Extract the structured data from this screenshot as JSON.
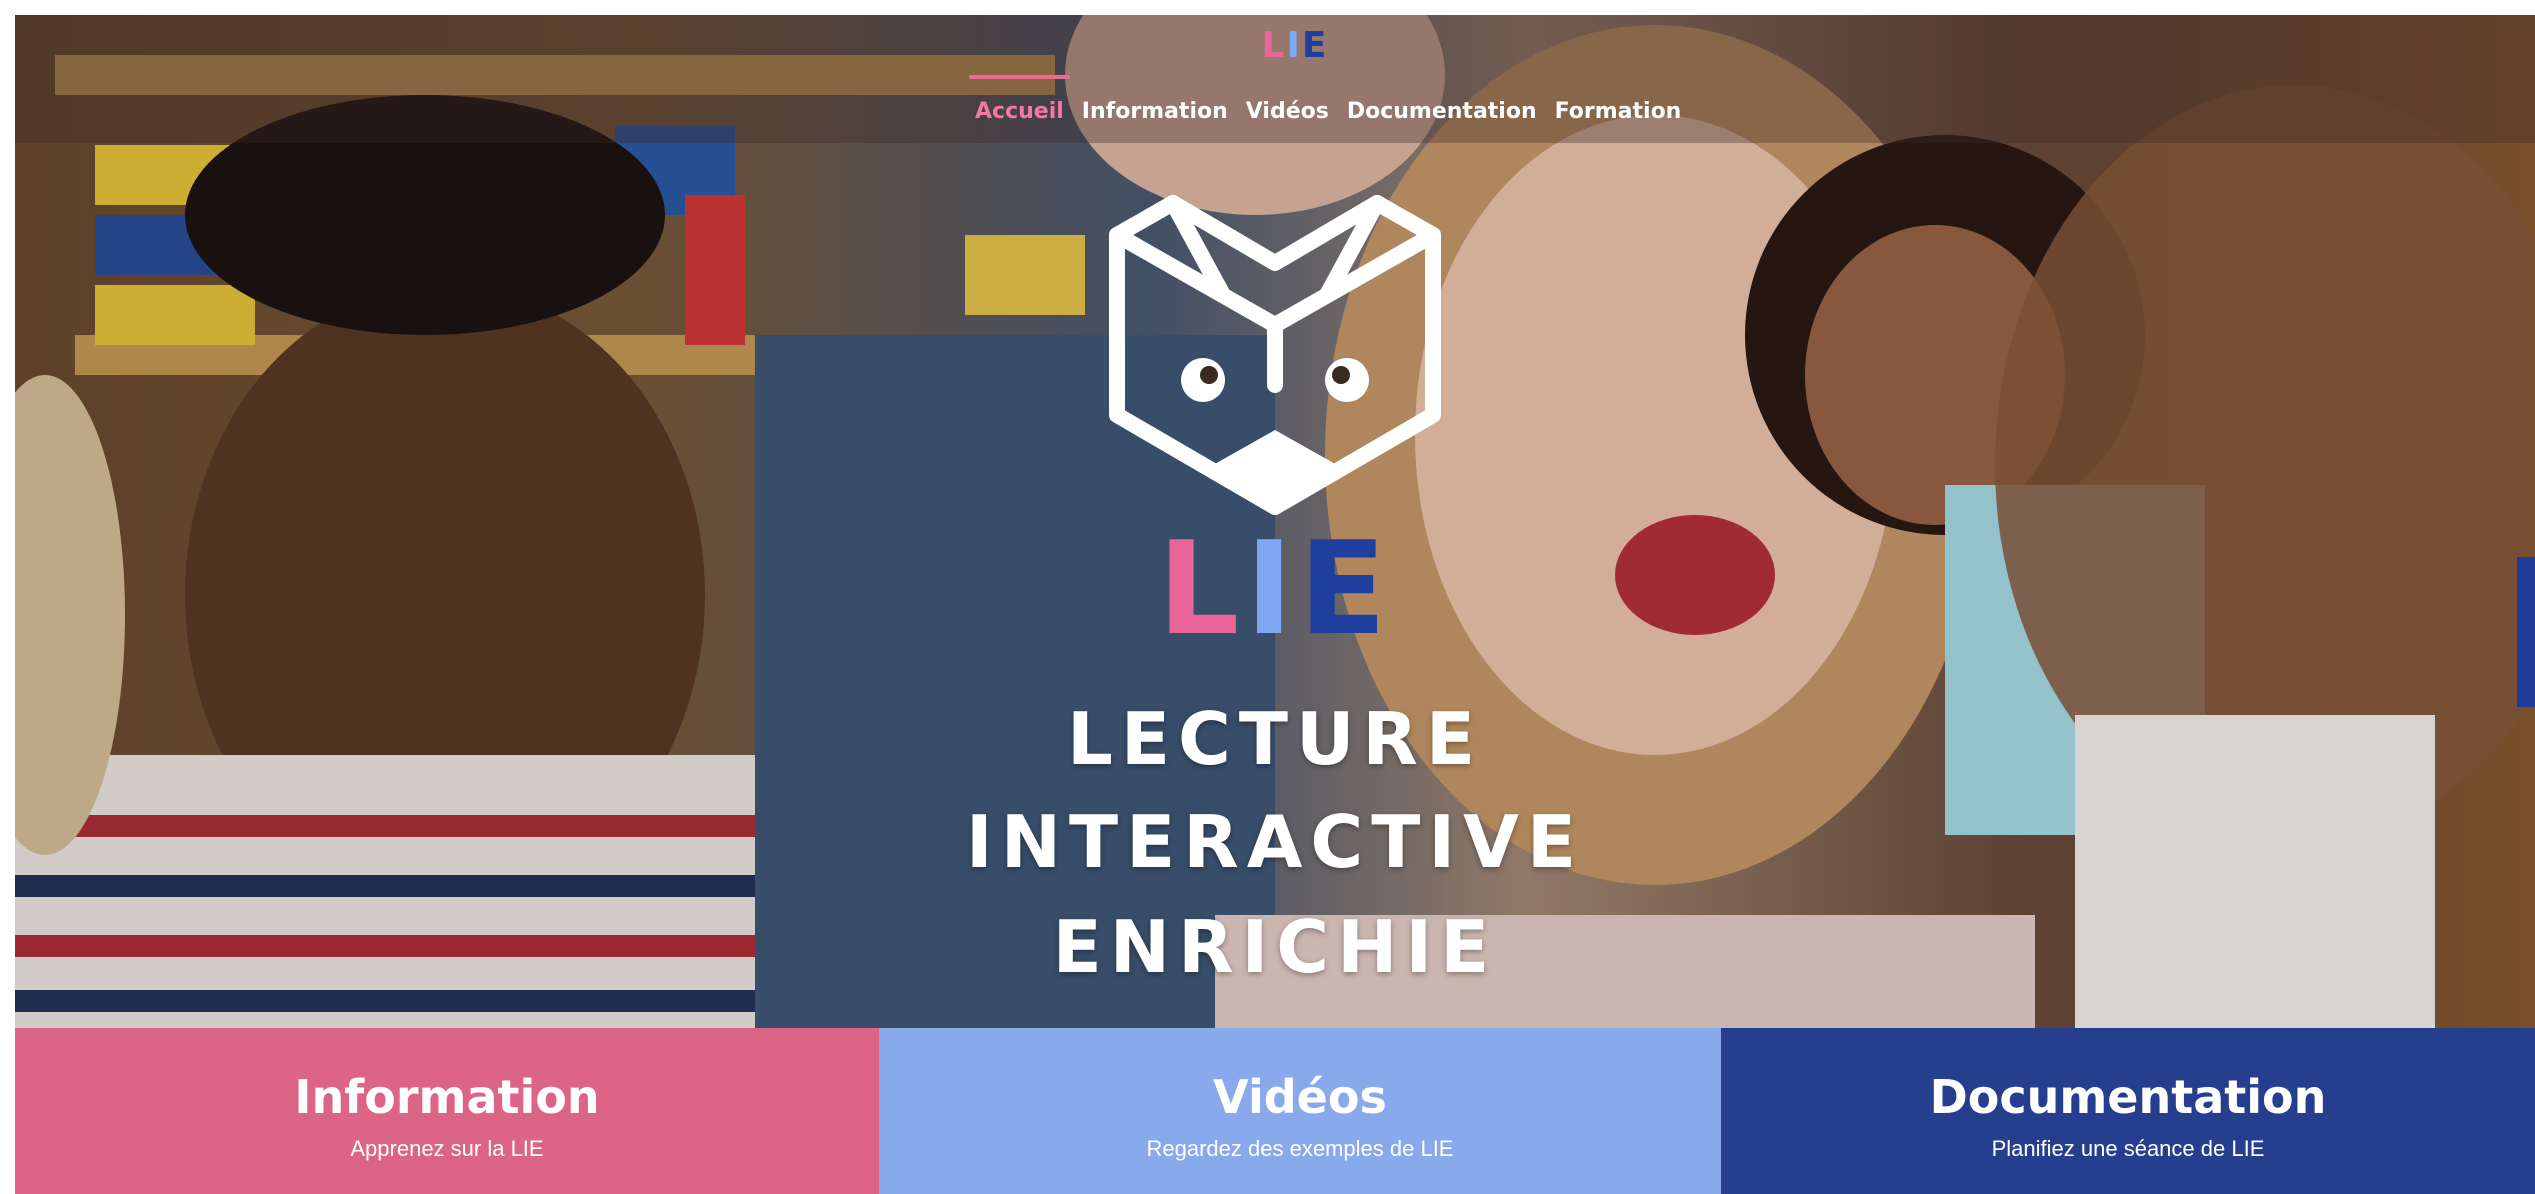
{
  "brand": {
    "letters": [
      "L",
      "I",
      "E"
    ]
  },
  "nav": {
    "items": [
      {
        "label": "Accueil",
        "active": true
      },
      {
        "label": "Information",
        "active": false
      },
      {
        "label": "Vidéos",
        "active": false
      },
      {
        "label": "Documentation",
        "active": false
      },
      {
        "label": "Formation",
        "active": false
      }
    ]
  },
  "hero": {
    "title_lines": [
      "LECTURE",
      "INTERACTIVE",
      "ENRICHIE"
    ]
  },
  "cards": [
    {
      "title": "Information",
      "subtitle": "Apprenez sur la LIE",
      "color": "#dc6585"
    },
    {
      "title": "Vidéos",
      "subtitle": "Regardez des exemples de LIE",
      "color": "#88a9ec"
    },
    {
      "title": "Documentation",
      "subtitle": "Planifiez une séance de LIE",
      "color": "#253f8e"
    }
  ],
  "colors": {
    "pink": "#e9669b",
    "light_blue": "#7ea8f1",
    "navy": "#1f3f9f"
  },
  "icons": {
    "logo": "fox-cube-logo-icon"
  }
}
